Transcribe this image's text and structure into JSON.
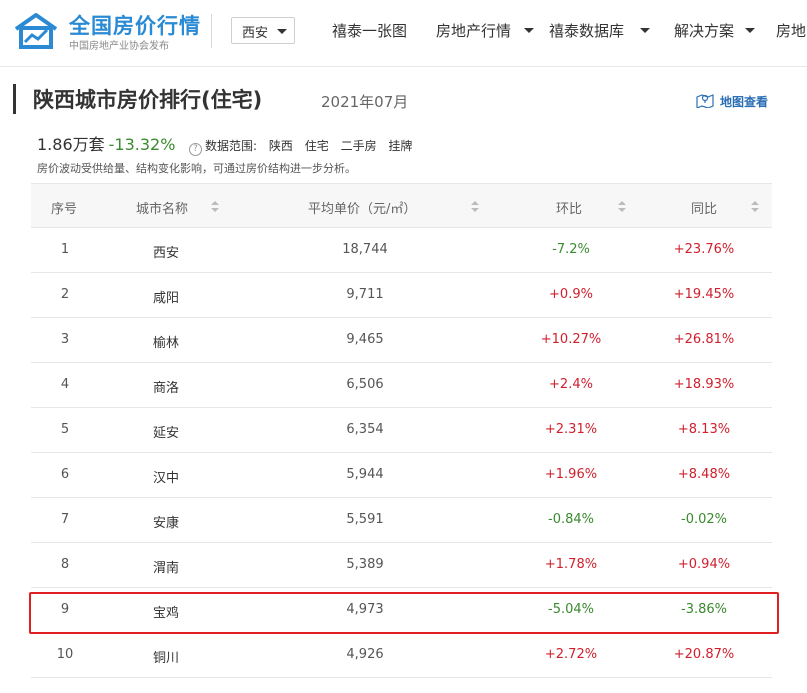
{
  "header": {
    "logo_title": "全国房价行情",
    "logo_subtitle": "中国房地产业协会发布",
    "city_select": "西安",
    "nav": [
      "禧泰一张图",
      "房地产行情",
      "禧泰数据库",
      "解决方案",
      "房地"
    ]
  },
  "page": {
    "title": "陕西城市房价排行(住宅)",
    "date": "2021年07月",
    "map_link": "地图查看",
    "listing_count": "1.86万套",
    "change": "-13.32%",
    "scope_label": "数据范围:",
    "scope_values": [
      "陕西",
      "住宅",
      "二手房",
      "挂牌"
    ],
    "note": "房价波动受供给量、结构变化影响，可通过房价结构进一步分析。"
  },
  "table": {
    "headers": [
      "序号",
      "城市名称",
      "平均单价（元/㎡）",
      "环比",
      "同比"
    ],
    "rows": [
      {
        "rank": "1",
        "city": "西安",
        "price": "18,744",
        "mom": "-7.2%",
        "yoy": "+23.76%"
      },
      {
        "rank": "2",
        "city": "咸阳",
        "price": "9,711",
        "mom": "+0.9%",
        "yoy": "+19.45%"
      },
      {
        "rank": "3",
        "city": "榆林",
        "price": "9,465",
        "mom": "+10.27%",
        "yoy": "+26.81%"
      },
      {
        "rank": "4",
        "city": "商洛",
        "price": "6,506",
        "mom": "+2.4%",
        "yoy": "+18.93%"
      },
      {
        "rank": "5",
        "city": "延安",
        "price": "6,354",
        "mom": "+2.31%",
        "yoy": "+8.13%"
      },
      {
        "rank": "6",
        "city": "汉中",
        "price": "5,944",
        "mom": "+1.96%",
        "yoy": "+8.48%"
      },
      {
        "rank": "7",
        "city": "安康",
        "price": "5,591",
        "mom": "-0.84%",
        "yoy": "-0.02%"
      },
      {
        "rank": "8",
        "city": "渭南",
        "price": "5,389",
        "mom": "+1.78%",
        "yoy": "+0.94%"
      },
      {
        "rank": "9",
        "city": "宝鸡",
        "price": "4,973",
        "mom": "-5.04%",
        "yoy": "-3.86%"
      },
      {
        "rank": "10",
        "city": "铜川",
        "price": "4,926",
        "mom": "+2.72%",
        "yoy": "+20.87%"
      }
    ],
    "highlighted_rank": "9"
  },
  "colors": {
    "brand": "#2b8ad4",
    "up": "#d0202d",
    "down": "#3a8a2e",
    "highlight_border": "#e02020"
  }
}
